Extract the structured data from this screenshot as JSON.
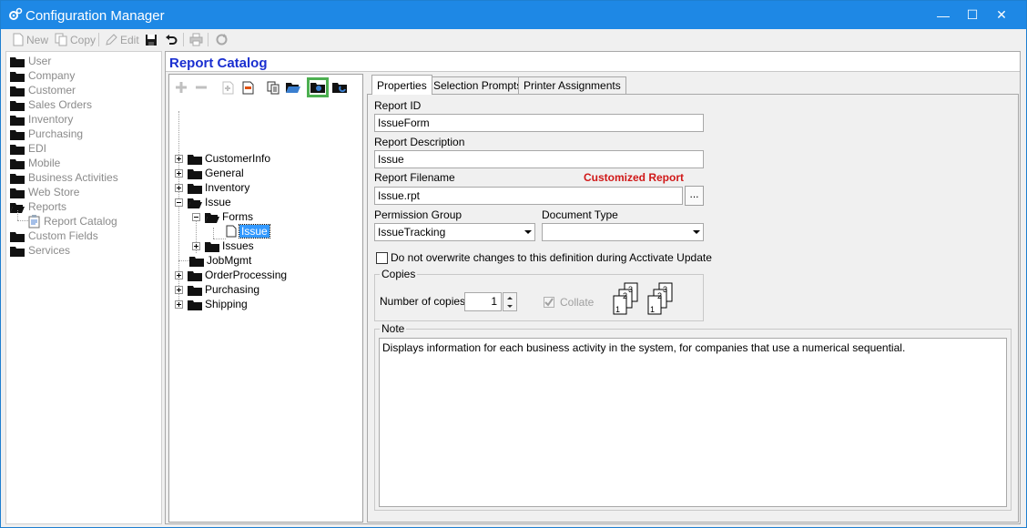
{
  "window": {
    "title": "Configuration Manager",
    "minimize": "—",
    "maximize": "☐",
    "close": "✕"
  },
  "toolbar": {
    "new_label": "New",
    "copy_label": "Copy",
    "edit_label": "Edit"
  },
  "nav": {
    "items": [
      {
        "label": "User"
      },
      {
        "label": "Company"
      },
      {
        "label": "Customer"
      },
      {
        "label": "Sales Orders"
      },
      {
        "label": "Inventory"
      },
      {
        "label": "Purchasing"
      },
      {
        "label": "EDI"
      },
      {
        "label": "Mobile"
      },
      {
        "label": "Business Activities"
      },
      {
        "label": "Web Store"
      },
      {
        "label": "Reports"
      },
      {
        "label": "Report Catalog"
      },
      {
        "label": "Custom Fields"
      },
      {
        "label": "Services"
      }
    ]
  },
  "catalog": {
    "title": "Report Catalog",
    "tree": [
      {
        "label": "CustomerInfo"
      },
      {
        "label": "General"
      },
      {
        "label": "Inventory"
      },
      {
        "label": "Issue"
      },
      {
        "label": "Forms"
      },
      {
        "label": "Issue"
      },
      {
        "label": "Issues"
      },
      {
        "label": "JobMgmt"
      },
      {
        "label": "OrderProcessing"
      },
      {
        "label": "Purchasing"
      },
      {
        "label": "Shipping"
      }
    ]
  },
  "tabs": [
    {
      "label": "Properties"
    },
    {
      "label": "Selection Prompts"
    },
    {
      "label": "Printer Assignments"
    }
  ],
  "form": {
    "report_id_label": "Report ID",
    "report_id": "IssueForm",
    "description_label": "Report Description",
    "description": "Issue",
    "filename_label": "Report Filename",
    "customized_label": "Customized Report",
    "filename": "Issue.rpt",
    "browse_label": "...",
    "permission_label": "Permission Group",
    "permission_value": "IssueTracking",
    "doctype_label": "Document Type",
    "doctype_value": "",
    "overwrite_label": "Do not overwrite changes to this definition during Acctivate Update",
    "copies_group": "Copies",
    "copies_label": "Number of copies:",
    "copies_value": "1",
    "collate_label": "Collate",
    "note_group": "Note",
    "note_text": "Displays information for each business activity in the system, for companies that use a numerical sequential."
  },
  "colors": {
    "title_bar": "#1e88e5",
    "catalog_title": "#1a2fd0",
    "customized": "#d01818",
    "selected": "#3399ff",
    "highlight": "#4caf50"
  }
}
